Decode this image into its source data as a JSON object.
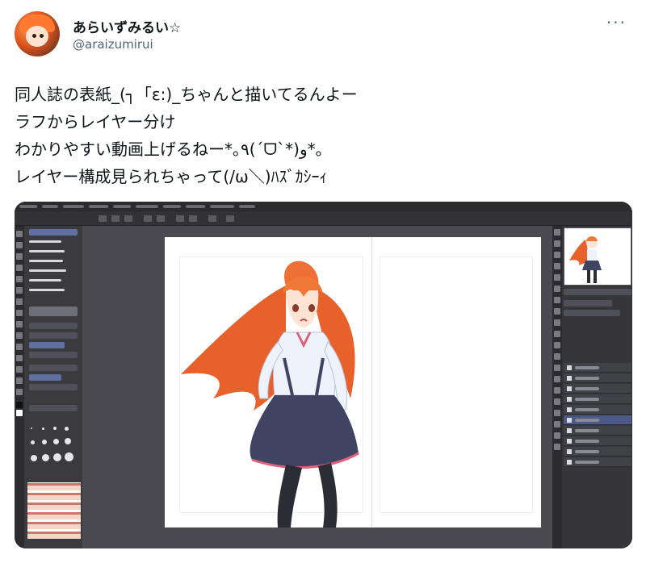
{
  "post": {
    "author": {
      "display_name": "あらいずみるい☆",
      "handle": "@araizumirui"
    },
    "more_label": "···",
    "text_lines": [
      "同人誌の表紙_(┐「ε:)_ちゃんと描いてるんよー",
      "ラフからレイヤー分け",
      "わかりやすい動画上げるねー*｡٩(ˊᗜˋ*)و*｡",
      "レイヤー構成見られちゃって(/ω＼)ﾊｽﾞｶｼｰｨ"
    ]
  },
  "media": {
    "type": "video-screenshot",
    "application": "painting-software",
    "colors": {
      "hair": "#e8602a",
      "skirt": "#3f4462",
      "shirt": "#eef2fb",
      "ribbon": "#e0607a",
      "legs": "#2c2c34"
    }
  }
}
